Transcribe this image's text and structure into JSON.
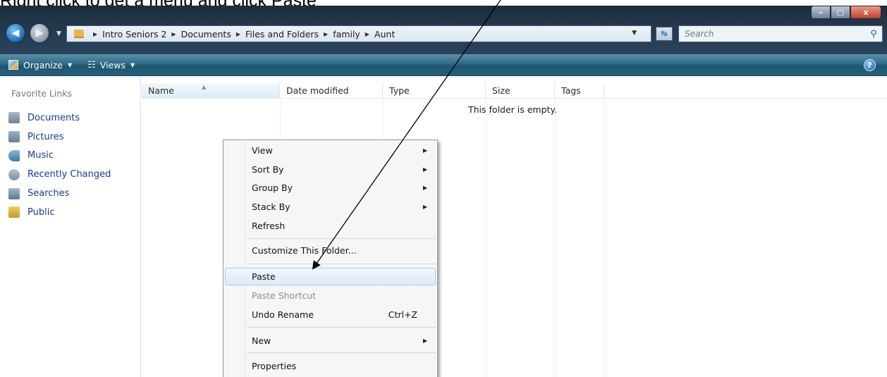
{
  "caption": "Right click to get a menu and click Paste",
  "window": {
    "minimize_label": "–",
    "maximize_label": "▢",
    "close_label": "x"
  },
  "address_bar": {
    "crumbs": [
      "Intro Seniors 2",
      "Documents",
      "Files and Folders",
      "family",
      "Aunt"
    ],
    "search_placeholder": "Search"
  },
  "toolbar": {
    "organize_label": "Organize",
    "views_label": "Views",
    "help_label": "?"
  },
  "nav_pane": {
    "title": "Favorite Links",
    "items": [
      "Documents",
      "Pictures",
      "Music",
      "Recently Changed",
      "Searches",
      "Public"
    ]
  },
  "columns": [
    "Name",
    "Date modified",
    "Type",
    "Size",
    "Tags"
  ],
  "content": {
    "empty_message": "This folder is empty."
  },
  "context_menu": {
    "items": [
      {
        "label": "View",
        "submenu": true
      },
      {
        "label": "Sort By",
        "submenu": true
      },
      {
        "label": "Group By",
        "submenu": true
      },
      {
        "label": "Stack By",
        "submenu": true
      },
      {
        "label": "Refresh"
      },
      {
        "label": "Customize This Folder..."
      },
      {
        "label": "Paste",
        "highlighted": true
      },
      {
        "label": "Paste Shortcut",
        "disabled": true
      },
      {
        "label": "Undo Rename",
        "shortcut": "Ctrl+Z"
      },
      {
        "label": "New",
        "submenu": true
      },
      {
        "label": "Properties"
      }
    ]
  },
  "colors": {
    "link_blue": "#1b3a8e",
    "toolbar_teal": "#2f6a86",
    "menu_highlight_border": "#a8cbe8"
  }
}
